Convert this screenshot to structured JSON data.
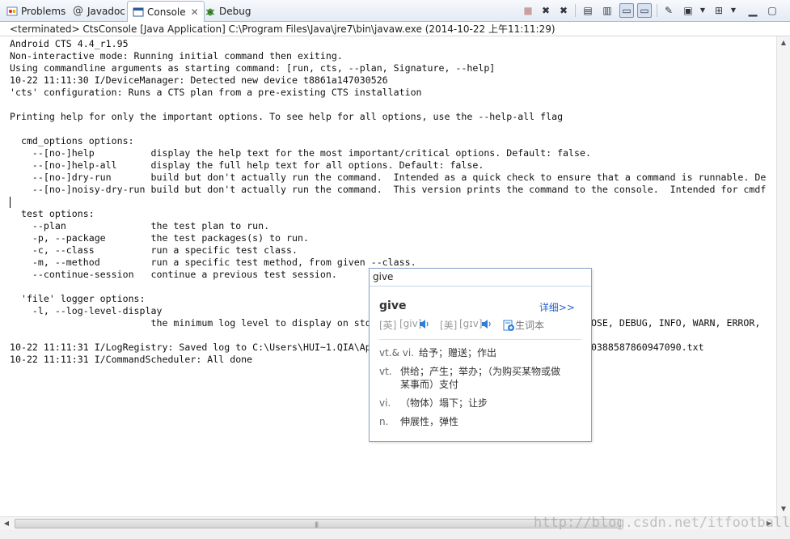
{
  "tabs": [
    {
      "label": "Problems",
      "icon": "problems-icon"
    },
    {
      "label": "Javadoc",
      "icon": "at-icon"
    },
    {
      "label": "Console",
      "icon": "console-icon",
      "active": true
    },
    {
      "label": "Debug",
      "icon": "debug-bug-icon"
    }
  ],
  "status": "<terminated> CtsConsole [Java Application] C:\\Program Files\\Java\\jre7\\bin\\javaw.exe (2014-10-22 上午11:11:29)",
  "console_lines": [
    "Android CTS 4.4_r1.95",
    "Non-interactive mode: Running initial command then exiting.",
    "Using commandline arguments as starting command: [run, cts, --plan, Signature, --help]",
    "10-22 11:11:30 I/DeviceManager: Detected new device t8861a147030526",
    "'cts' configuration: Runs a CTS plan from a pre-existing CTS installation",
    "",
    "Printing help for only the important options. To see help for all options, use the --help-all flag",
    "",
    "  cmd_options options:",
    "    --[no-]help          display the help text for the most important/critical options. Default: false.",
    "    --[no-]help-all      display the full help text for all options. Default: false.",
    "    --[no-]dry-run       build but don't actually run the command.  Intended as a quick check to ensure that a command is runnable. De",
    "    --[no-]noisy-dry-run build but don't actually run the command.  This version prints the command to the console.  Intended for cmdf",
    "",
    "  test options:",
    "    --plan               the test plan to run.",
    "    -p, --package        the test packages(s) to run.",
    "    -c, --class          run a specific test class.",
    "    -m, --method         run a specific test method, from given --class.",
    "    --continue-session   continue a previous test session.",
    "",
    "  'file' logger options:",
    "    -l, --log-level-display",
    "                         the minimum log level to display on sto                                      BOSE, DEBUG, INFO, WARN, ERROR,",
    "",
    "10-22 11:11:31 I/LogRegistry: Saved log to C:\\Users\\HUI~1.QIA\\Ap                                      60388587860947090.txt",
    "10-22 11:11:31 I/CommandScheduler: All done"
  ],
  "dictionary": {
    "query": "give",
    "word": "give",
    "more_link": "详细>>",
    "uk_label": "[英]",
    "uk_phonetic": "[giv]",
    "us_label": "[美]",
    "us_phonetic": "[gɪv]",
    "add_to_wordbook": "生词本",
    "definitions": [
      {
        "pos": "vt.& vi.",
        "text": "给予；赠送；作出"
      },
      {
        "pos": "vt.",
        "text": "供给；产生；举办；（为购买某物或做某事而）支付"
      },
      {
        "pos": "vi.",
        "text": "（物体）塌下；让步"
      },
      {
        "pos": "n.",
        "text": "伸展性，弹性"
      }
    ]
  },
  "watermark": "http://blog.csdn.net/itfootball",
  "colors": {
    "link": "#2a64c8",
    "speaker": "#2f7fd8",
    "tab_border": "#a9b8cc"
  }
}
